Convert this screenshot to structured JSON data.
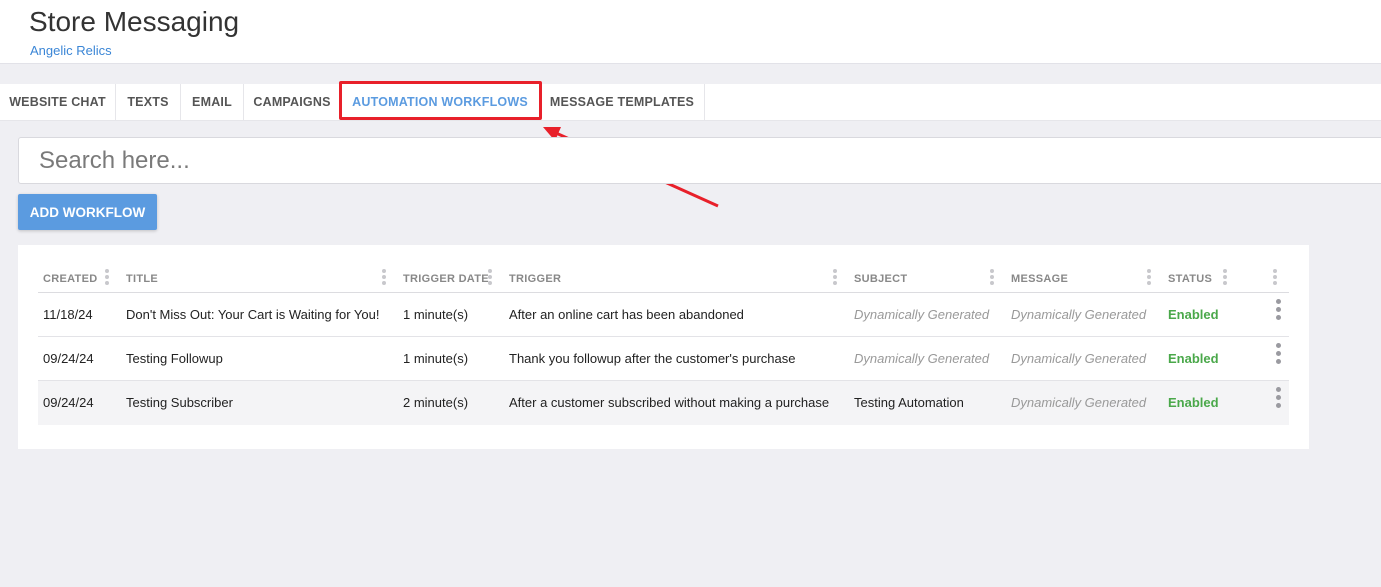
{
  "header": {
    "title": "Store Messaging",
    "subtitle": "Angelic Relics"
  },
  "tabs": [
    {
      "label": "WEBSITE CHAT",
      "active": false
    },
    {
      "label": "TEXTS",
      "active": false
    },
    {
      "label": "EMAIL",
      "active": false
    },
    {
      "label": "CAMPAIGNS",
      "active": false
    },
    {
      "label": "AUTOMATION WORKFLOWS",
      "active": true
    },
    {
      "label": "MESSAGE TEMPLATES",
      "active": false
    }
  ],
  "search": {
    "placeholder": "Search here...",
    "value": ""
  },
  "toolbar": {
    "add_label": "ADD WORKFLOW"
  },
  "table": {
    "columns": [
      "CREATED",
      "TITLE",
      "TRIGGER DATE",
      "TRIGGER",
      "SUBJECT",
      "MESSAGE",
      "STATUS"
    ],
    "rows": [
      {
        "created": "11/18/24",
        "title": "Don't Miss Out: Your Cart is Waiting for You!",
        "trigger_date": "1 minute(s)",
        "trigger": "After an online cart has been abandoned",
        "subject": "Dynamically Generated",
        "message": "Dynamically Generated",
        "status": "Enabled"
      },
      {
        "created": "09/24/24",
        "title": "Testing Followup",
        "trigger_date": "1 minute(s)",
        "trigger": "Thank you followup after the customer's purchase",
        "subject": "Dynamically Generated",
        "message": "Dynamically Generated",
        "status": "Enabled"
      },
      {
        "created": "09/24/24",
        "title": "Testing Subscriber",
        "trigger_date": "2 minute(s)",
        "trigger": "After a customer subscribed without making a purchase",
        "subject": "Testing Automation",
        "message": "Dynamically Generated",
        "status": "Enabled"
      }
    ]
  },
  "colors": {
    "accent": "#5b9be0",
    "status_enabled": "#4aa84a",
    "annotation": "#e8202a"
  },
  "icons": {
    "row_menu": "more-vertical-icon",
    "column_resize": "drag-handle-icon"
  }
}
